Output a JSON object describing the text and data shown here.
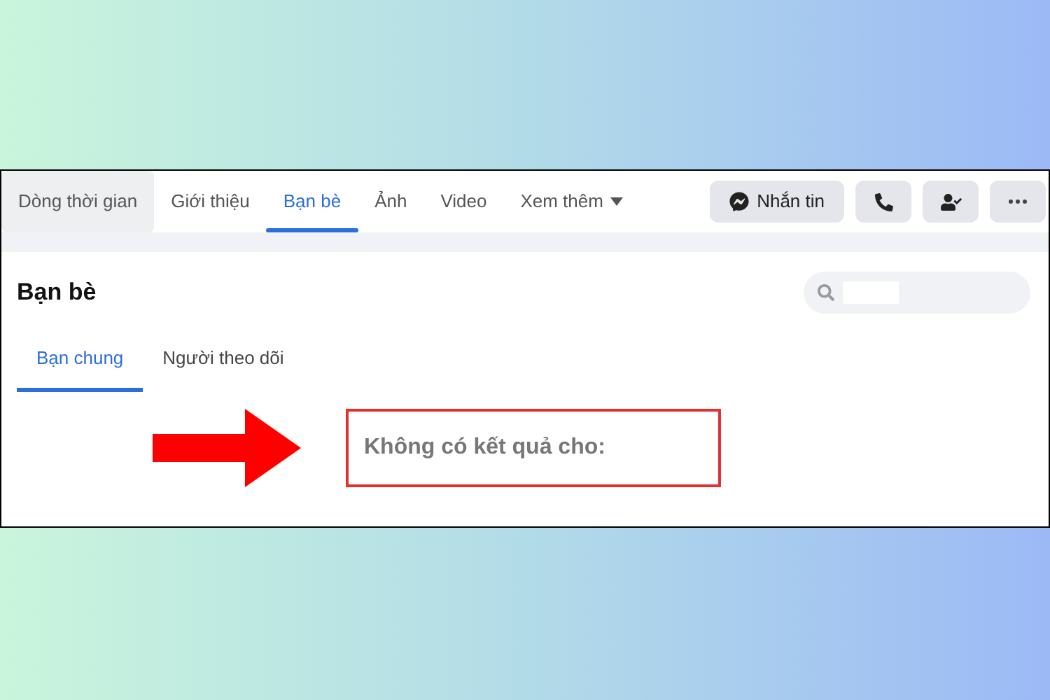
{
  "tabs": [
    {
      "label": "Dòng thời gian",
      "selected": false,
      "highlighted": true
    },
    {
      "label": "Giới thiệu",
      "selected": false,
      "highlighted": false
    },
    {
      "label": "Bạn bè",
      "selected": true,
      "highlighted": false
    },
    {
      "label": "Ảnh",
      "selected": false,
      "highlighted": false
    },
    {
      "label": "Video",
      "selected": false,
      "highlighted": false
    },
    {
      "label": "Xem thêm",
      "selected": false,
      "highlighted": false,
      "dropdown": true
    }
  ],
  "actions": [
    {
      "kind": "message",
      "label": "Nhắn tin"
    },
    {
      "kind": "call"
    },
    {
      "kind": "friend"
    },
    {
      "kind": "more"
    }
  ],
  "section": {
    "title": "Bạn bè"
  },
  "subtabs": [
    {
      "label": "Bạn chung",
      "selected": true
    },
    {
      "label": "Người theo dõi",
      "selected": false
    }
  ],
  "result": {
    "text": "Không có kết quả cho:"
  }
}
